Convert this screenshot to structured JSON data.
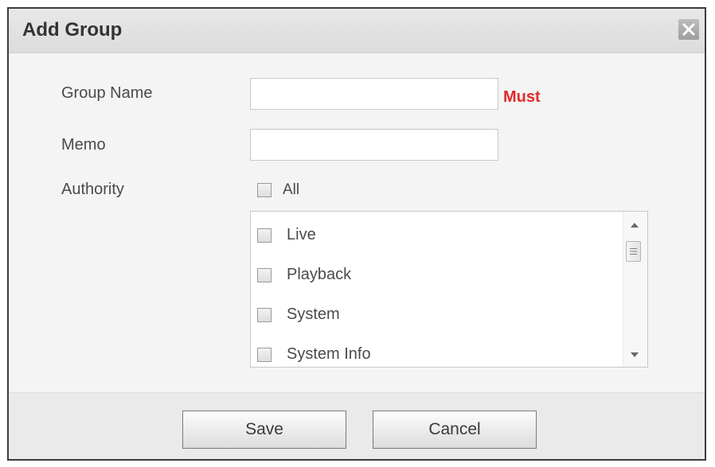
{
  "dialog": {
    "title": "Add Group",
    "close_icon": "close-x-icon"
  },
  "form": {
    "group_name": {
      "label": "Group Name",
      "value": "",
      "required_text": "Must"
    },
    "memo": {
      "label": "Memo",
      "value": ""
    },
    "authority": {
      "label": "Authority",
      "all_label": "All",
      "all_checked": false,
      "items": [
        {
          "label": "Live",
          "checked": false
        },
        {
          "label": "Playback",
          "checked": false
        },
        {
          "label": "System",
          "checked": false
        },
        {
          "label": "System Info",
          "checked": false
        }
      ]
    }
  },
  "buttons": {
    "save_label": "Save",
    "cancel_label": "Cancel"
  },
  "colors": {
    "required": "#e02b2b",
    "titlebar": "#e0e0e0",
    "body": "#f4f4f4"
  }
}
